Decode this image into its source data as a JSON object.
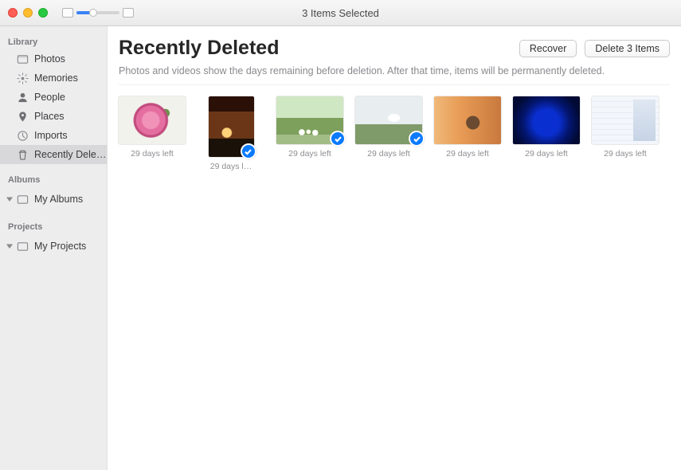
{
  "window": {
    "title": "3 Items Selected"
  },
  "sidebar": {
    "sections": {
      "library": {
        "label": "Library",
        "items": [
          {
            "label": "Photos"
          },
          {
            "label": "Memories"
          },
          {
            "label": "People"
          },
          {
            "label": "Places"
          },
          {
            "label": "Imports"
          },
          {
            "label": "Recently Dele…"
          }
        ]
      },
      "albums": {
        "label": "Albums",
        "item": "My Albums"
      },
      "projects": {
        "label": "Projects",
        "item": "My Projects"
      }
    }
  },
  "main": {
    "title": "Recently Deleted",
    "subtitle": "Photos and videos show the days remaining before deletion. After that time, items will be permanently deleted.",
    "actions": {
      "recover": "Recover",
      "delete": "Delete 3 Items"
    }
  },
  "items": [
    {
      "caption": "29 days left",
      "selected": false,
      "tall": false,
      "style": "p-rose"
    },
    {
      "caption": "29 days l…",
      "selected": true,
      "tall": true,
      "style": "p-forest"
    },
    {
      "caption": "29 days left",
      "selected": true,
      "tall": false,
      "style": "p-family"
    },
    {
      "caption": "29 days left",
      "selected": true,
      "tall": false,
      "style": "p-sheep"
    },
    {
      "caption": "29 days left",
      "selected": false,
      "tall": false,
      "style": "p-woman"
    },
    {
      "caption": "29 days left",
      "selected": false,
      "tall": false,
      "style": "p-bluerose"
    },
    {
      "caption": "29 days left",
      "selected": false,
      "tall": false,
      "style": "p-screenshot"
    }
  ]
}
